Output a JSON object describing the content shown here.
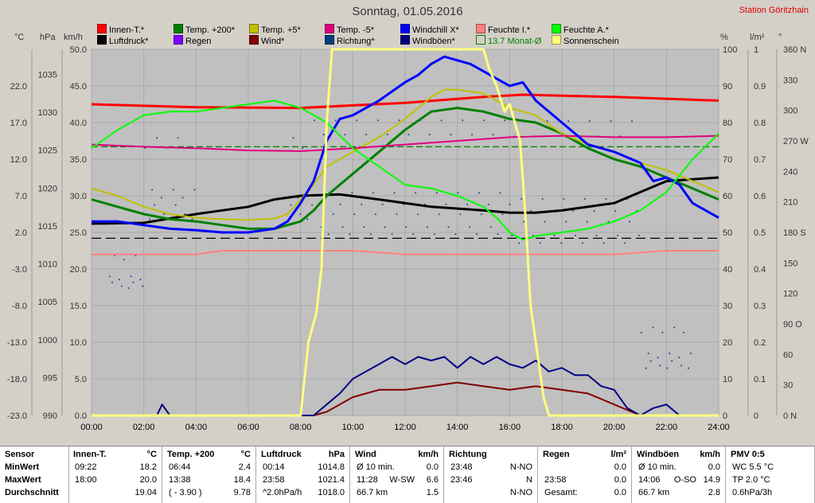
{
  "header": {
    "title": "Sonntag, 01.05.2016",
    "station": "Station Göritzhain"
  },
  "legend": [
    {
      "label": "Innen-T.*",
      "color": "#ff0000"
    },
    {
      "label": "Luftdruck*",
      "color": "#000000"
    },
    {
      "label": "Temp. +200*",
      "color": "#008000"
    },
    {
      "label": "Regen",
      "color": "#8000ff"
    },
    {
      "label": "Temp. +5*",
      "color": "#c0c000"
    },
    {
      "label": "Wind*",
      "color": "#800000"
    },
    {
      "label": "Temp. -5*",
      "color": "#e0007f"
    },
    {
      "label": "Richtung*",
      "color": "#004080"
    },
    {
      "label": "Windchill X*",
      "color": "#0000ff"
    },
    {
      "label": "Windböen*",
      "color": "#000080"
    },
    {
      "label": "Feuchte I.*",
      "color": "#ff8080"
    },
    {
      "label": "13.7 Monat-Ø",
      "color": "#008000"
    },
    {
      "label": "Feuchte A.*",
      "color": "#00ff00"
    },
    {
      "label": "Sonnenschein",
      "color": "#ffff80"
    }
  ],
  "units": {
    "temp": "°C",
    "pressure": "hPa",
    "wind": "km/h",
    "percent": "%",
    "rain": "l/m²",
    "degree": "°"
  },
  "chart_data": {
    "type": "line",
    "title": "Sonntag, 01.05.2016",
    "x_ticks": [
      "00:00",
      "02:00",
      "04:00",
      "06:00",
      "08:00",
      "10:00",
      "12:00",
      "14:00",
      "16:00",
      "18:00",
      "20:00",
      "22:00",
      "24:00"
    ],
    "xlim": [
      0,
      24
    ],
    "axes": {
      "temp": {
        "range": [
          -23,
          27
        ],
        "ticks": [
          "22.0",
          "17.0",
          "12.0",
          "7.0",
          "2.0",
          "-3.0",
          "-8.0",
          "-13.0",
          "-18.0",
          "-23.0"
        ]
      },
      "pressure": {
        "range": [
          990,
          1038.3
        ],
        "ticks": [
          "1035",
          "1030",
          "1025",
          "1020",
          "1015",
          "1010",
          "1005",
          "1000",
          "995",
          "990"
        ]
      },
      "wind": {
        "range": [
          0,
          50
        ],
        "ticks": [
          "50.0",
          "45.0",
          "40.0",
          "35.0",
          "30.0",
          "25.0",
          "20.0",
          "15.0",
          "10.0",
          "5.0",
          "0.0"
        ]
      },
      "percent": {
        "range": [
          0,
          100
        ],
        "ticks": [
          "100",
          "90",
          "80",
          "70",
          "60",
          "50",
          "40",
          "30",
          "20",
          "10",
          "0"
        ]
      },
      "rain": {
        "range": [
          0,
          1
        ],
        "ticks": [
          "1",
          "0.9",
          "0.8",
          "0.7",
          "0.6",
          "0.5",
          "0.4",
          "0.3",
          "0.2",
          "0.1",
          "0"
        ]
      },
      "direction": {
        "range": [
          0,
          360
        ],
        "ticks": [
          "360 N",
          "330",
          "300",
          "270 W",
          "240",
          "210",
          "180 S",
          "150",
          "120",
          "90 O",
          "60",
          "30",
          "0 N"
        ]
      }
    },
    "series": [
      {
        "name": "Innen-T.*",
        "color": "#ff0000",
        "axis": "wind",
        "width": 3,
        "x": [
          0,
          4,
          8,
          12,
          15,
          16.5,
          20,
          24
        ],
        "y": [
          42.5,
          42.1,
          42.0,
          42.7,
          43.5,
          43.8,
          43.5,
          43.0
        ]
      },
      {
        "name": "Luftdruck*",
        "color": "#000000",
        "axis": "wind",
        "width": 3,
        "x": [
          0,
          2,
          4,
          6,
          7,
          8,
          9.5,
          11,
          13,
          15,
          16,
          17,
          18,
          20,
          21,
          22,
          24
        ],
        "y": [
          26.2,
          26.3,
          27.5,
          28.5,
          29.5,
          30.0,
          30.2,
          29.5,
          28.5,
          28.0,
          27.7,
          27.7,
          28.0,
          29.0,
          30.5,
          32.0,
          32.5
        ]
      },
      {
        "name": "Temp. +200*",
        "color": "#008000",
        "axis": "wind",
        "width": 3,
        "x": [
          0,
          1,
          2,
          3,
          4,
          5,
          6,
          7,
          8,
          8.5,
          9,
          10,
          11,
          12,
          13,
          14,
          15,
          16,
          17,
          18,
          19,
          20,
          21,
          22,
          23,
          24
        ],
        "y": [
          29.5,
          28.5,
          27.5,
          26.8,
          26.5,
          26.0,
          25.5,
          25.5,
          26.5,
          28,
          30,
          33,
          36,
          39,
          41.5,
          42,
          41.5,
          40.5,
          40,
          38.5,
          36.5,
          35,
          34,
          32.5,
          31,
          29.5
        ]
      },
      {
        "name": "Temp. +5*",
        "color": "#c0c000",
        "axis": "wind",
        "width": 2,
        "x": [
          0,
          1,
          2,
          3,
          4,
          5,
          6,
          7,
          7.5,
          8,
          8.5,
          9,
          9.5,
          10,
          11,
          12,
          13,
          13.5,
          14,
          15,
          15.5,
          16,
          16.5,
          17,
          18,
          19,
          20,
          21,
          22,
          23,
          24
        ],
        "y": [
          31,
          30,
          28.5,
          27.5,
          27.0,
          26.8,
          26.7,
          26.9,
          27.5,
          29.5,
          31.5,
          34,
          35,
          36,
          38,
          40.5,
          43.5,
          44.5,
          44.5,
          44,
          43,
          42,
          41.5,
          41,
          38.5,
          37,
          36,
          34.5,
          33.5,
          32,
          30.5
        ]
      },
      {
        "name": "Temp. -5*",
        "color": "#e0007f",
        "axis": "wind",
        "width": 2,
        "x": [
          0,
          2,
          4,
          6,
          8,
          10,
          12,
          14,
          16,
          18,
          20,
          22,
          24
        ],
        "y": [
          37,
          36.7,
          36.5,
          36.2,
          36.1,
          36.5,
          37,
          37.5,
          38,
          38.2,
          38.0,
          38.0,
          38.2
        ]
      },
      {
        "name": "Windchill X*",
        "color": "#0000ff",
        "axis": "wind",
        "width": 3,
        "x": [
          0,
          1,
          2,
          3,
          4,
          5,
          6,
          7,
          7.5,
          8,
          8.5,
          9,
          9.5,
          10,
          11,
          12,
          12.5,
          13,
          13.5,
          14,
          14.5,
          15,
          15.5,
          16,
          16.5,
          17,
          18,
          19,
          20,
          21,
          21.5,
          22,
          22.5,
          23,
          24
        ],
        "y": [
          26.5,
          26.5,
          26,
          25.5,
          25.3,
          25.0,
          25.0,
          25.5,
          26.5,
          29,
          32,
          37.5,
          40.5,
          41,
          43,
          45.5,
          46.5,
          48,
          49,
          48.5,
          48,
          47,
          46,
          45,
          45.5,
          43,
          40,
          37,
          36,
          34.5,
          32,
          32.5,
          31.5,
          29,
          27
        ]
      },
      {
        "name": "Feuchte I.*",
        "color": "#ff8080",
        "axis": "percent",
        "width": 2,
        "x": [
          0,
          2,
          4,
          5,
          10,
          11,
          12,
          15,
          20,
          21,
          22,
          24
        ],
        "y": [
          44,
          44,
          44,
          45,
          45,
          44.5,
          44,
          44,
          44,
          44.5,
          45,
          45
        ]
      },
      {
        "name": "Feuchte A.*",
        "color": "#00ff00",
        "axis": "percent",
        "width": 2,
        "x": [
          0,
          1,
          2,
          3,
          4,
          5,
          6,
          7,
          8,
          9,
          10,
          11,
          12,
          13,
          14,
          15,
          15.5,
          16,
          16.5,
          17,
          18,
          19,
          20,
          21,
          22,
          23,
          24
        ],
        "y": [
          73,
          78,
          82,
          83,
          83,
          84,
          85,
          86,
          84,
          80,
          73,
          68,
          63,
          62,
          60,
          57,
          54,
          50,
          48,
          49,
          50,
          51,
          53,
          56,
          61,
          70,
          77
        ]
      },
      {
        "name": "Wind*",
        "color": "#800000",
        "axis": "wind",
        "width": 2,
        "x": [
          0,
          8.5,
          9,
          9.5,
          10,
          11,
          12,
          13,
          14,
          15,
          16,
          17,
          18,
          19,
          20,
          21,
          24
        ],
        "y": [
          0,
          0,
          0.5,
          1.5,
          2.5,
          3.5,
          3.5,
          4,
          4.5,
          4,
          3.5,
          4,
          3.5,
          3,
          1.5,
          0,
          0
        ]
      },
      {
        "name": "Windböen*",
        "color": "#000080",
        "axis": "wind",
        "width": 2,
        "x": [
          0,
          2.5,
          2.7,
          3,
          8.5,
          9,
          9.5,
          10,
          10.5,
          11,
          11.5,
          12,
          12.5,
          13,
          13.5,
          14,
          14.5,
          15,
          15.5,
          16,
          16.5,
          17,
          17.5,
          18,
          18.5,
          19,
          19.5,
          20,
          20.5,
          21,
          21.5,
          22,
          22.5,
          24
        ],
        "y": [
          0,
          0,
          1.5,
          0,
          0,
          1.5,
          3,
          5,
          6,
          7,
          8,
          7,
          8,
          7.5,
          8,
          6.5,
          8,
          7,
          8,
          7,
          6.5,
          7.5,
          6,
          6.5,
          5.5,
          5.5,
          4,
          3.5,
          1,
          0,
          1,
          1.5,
          0,
          0
        ]
      },
      {
        "name": "Sonnenschein",
        "color": "#ffff80",
        "axis": "percent",
        "width": 3,
        "x": [
          0,
          8.0,
          8.3,
          8.6,
          8.8,
          9.0,
          9.2,
          9.6,
          10,
          15,
          15.2,
          15.5,
          15.8,
          16.0,
          16.2,
          16.4,
          16.6,
          16.8,
          17.0,
          17.3,
          17.5,
          24
        ],
        "y": [
          0,
          0,
          20,
          28,
          40,
          80,
          100,
          100,
          100,
          100,
          95,
          90,
          83,
          85,
          80,
          75,
          55,
          30,
          20,
          5,
          0,
          0
        ]
      }
    ],
    "reference_lines": [
      {
        "name": "13.7 Monat-Ø",
        "color": "#008000",
        "axis": "temp",
        "value": 13.7,
        "dash": "8,4"
      },
      {
        "name": "black dashed",
        "color": "#000000",
        "axis": "wind",
        "value": 24.2,
        "dash": "12,6"
      }
    ]
  },
  "stats": {
    "labels": {
      "sensor": "Sensor",
      "min": "MinWert",
      "max": "MaxWert",
      "avg": "Durchschnitt"
    },
    "sections": [
      {
        "title": "Innen-T.",
        "unit": "°C",
        "rows": [
          [
            "09:22",
            "",
            "18.2"
          ],
          [
            "18:00",
            "",
            "20.0"
          ],
          [
            "",
            "",
            "19.04"
          ]
        ]
      },
      {
        "title": "Temp. +200",
        "unit": "°C",
        "rows": [
          [
            "06:44",
            "",
            "2.4"
          ],
          [
            "13:38",
            "",
            "18.4"
          ],
          [
            "( - 3.90 )",
            "",
            "9.78"
          ]
        ]
      },
      {
        "title": "Luftdruck",
        "unit": "hPa",
        "rows": [
          [
            "00:14",
            "",
            "1014.8"
          ],
          [
            "23:58",
            "",
            "1021.4"
          ],
          [
            "^2.0hPa/h",
            "",
            "1018.0"
          ]
        ]
      },
      {
        "title": "Wind",
        "unit": "km/h",
        "rows": [
          [
            "Ø 10 min.",
            "",
            "0.0"
          ],
          [
            "11:28",
            "W-SW",
            "6.6"
          ],
          [
            "66.7 km",
            "",
            "1.5"
          ]
        ]
      },
      {
        "title": "Richtung",
        "unit": "",
        "rows": [
          [
            "23:48",
            "",
            "N-NO"
          ],
          [
            "23:46",
            "",
            "N"
          ],
          [
            "",
            "",
            "N-NO"
          ]
        ]
      },
      {
        "title": "Regen",
        "unit": "l/m²",
        "rows": [
          [
            "",
            "",
            "0.0"
          ],
          [
            "23:58",
            "",
            "0.0"
          ],
          [
            "Gesamt:",
            "",
            "0.0"
          ]
        ]
      },
      {
        "title": "Windböen",
        "unit": "km/h",
        "rows": [
          [
            "Ø 10 min.",
            "",
            "0.0"
          ],
          [
            "14:06",
            "O-SO",
            "14.9"
          ],
          [
            "66.7 km",
            "",
            "2.8"
          ]
        ]
      },
      {
        "title": "PMV 0:5",
        "unit": "",
        "rows": [
          [
            "WC 5.5 °C",
            "",
            ""
          ],
          [
            "TP 2.0 °C",
            "",
            ""
          ],
          [
            "0.6hPa/3h",
            "",
            ""
          ]
        ]
      }
    ]
  }
}
